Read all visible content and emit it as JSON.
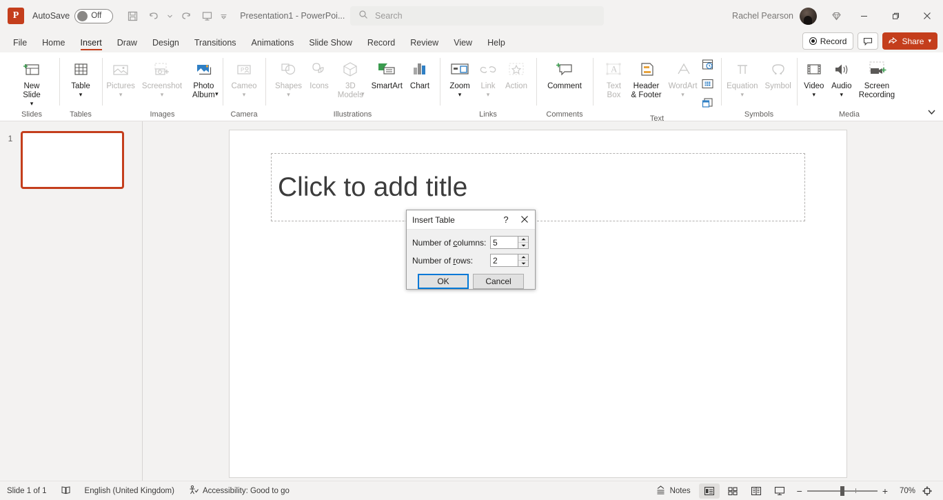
{
  "titlebar": {
    "app_icon": "powerpoint-logo",
    "app_initial": "P",
    "autosave_label": "AutoSave",
    "autosave_state": "Off",
    "quick_access": [
      {
        "name": "save-icon",
        "label": "Save"
      },
      {
        "name": "undo-icon",
        "label": "Undo"
      },
      {
        "name": "undo-dropdown-icon",
        "label": ""
      },
      {
        "name": "redo-icon",
        "label": "Redo"
      },
      {
        "name": "start-presentation-icon",
        "label": "Start From Beginning"
      },
      {
        "name": "customize-quick-access-toolbar-icon",
        "label": ""
      }
    ],
    "document_title": "Presentation1  -  PowerPoi...",
    "user_name": "Rachel Pearson",
    "window_buttons": [
      "minimize",
      "restore",
      "close"
    ]
  },
  "search": {
    "placeholder": "Search",
    "icon": "search-icon"
  },
  "tabs": [
    {
      "label": "File",
      "active": false
    },
    {
      "label": "Home",
      "active": false
    },
    {
      "label": "Insert",
      "active": true
    },
    {
      "label": "Draw",
      "active": false
    },
    {
      "label": "Design",
      "active": false
    },
    {
      "label": "Transitions",
      "active": false
    },
    {
      "label": "Animations",
      "active": false
    },
    {
      "label": "Slide Show",
      "active": false
    },
    {
      "label": "Record",
      "active": false
    },
    {
      "label": "Review",
      "active": false
    },
    {
      "label": "View",
      "active": false
    },
    {
      "label": "Help",
      "active": false
    }
  ],
  "tabbar_right": {
    "record_label": "Record",
    "comments_icon": "comment-icon",
    "share_label": "Share"
  },
  "ribbon": {
    "groups": [
      {
        "name": "Slides",
        "items": [
          {
            "label": "New\nSlide",
            "icon": "new-slide-icon",
            "disabled": false,
            "dropdown": true
          }
        ]
      },
      {
        "name": "Tables",
        "items": [
          {
            "label": "Table",
            "icon": "table-icon",
            "disabled": false,
            "dropdown": true
          }
        ]
      },
      {
        "name": "Images",
        "items": [
          {
            "label": "Pictures",
            "icon": "pictures-icon",
            "disabled": true,
            "dropdown": true
          },
          {
            "label": "Screenshot",
            "icon": "screenshot-icon",
            "disabled": true,
            "dropdown": true
          },
          {
            "label": "Photo\nAlbum",
            "icon": "photo-album-icon",
            "disabled": false,
            "dropdown": true
          }
        ]
      },
      {
        "name": "Camera",
        "items": [
          {
            "label": "Cameo",
            "icon": "cameo-icon",
            "disabled": true,
            "dropdown": true
          }
        ]
      },
      {
        "name": "Illustrations",
        "items": [
          {
            "label": "Shapes",
            "icon": "shapes-icon",
            "disabled": true,
            "dropdown": true
          },
          {
            "label": "Icons",
            "icon": "icons-icon",
            "disabled": true,
            "dropdown": false
          },
          {
            "label": "3D\nModels",
            "icon": "3d-models-icon",
            "disabled": true,
            "dropdown": true
          },
          {
            "label": "SmartArt",
            "icon": "smartart-icon",
            "disabled": false,
            "dropdown": false
          },
          {
            "label": "Chart",
            "icon": "chart-icon",
            "disabled": false,
            "dropdown": false
          }
        ]
      },
      {
        "name": "Links",
        "items": [
          {
            "label": "Zoom",
            "icon": "zoom-icon",
            "disabled": false,
            "dropdown": true
          },
          {
            "label": "Link",
            "icon": "link-icon",
            "disabled": true,
            "dropdown": true
          },
          {
            "label": "Action",
            "icon": "action-icon",
            "disabled": true,
            "dropdown": false
          }
        ]
      },
      {
        "name": "Comments",
        "items": [
          {
            "label": "Comment",
            "icon": "comment-icon",
            "disabled": false,
            "dropdown": false
          }
        ]
      },
      {
        "name": "Text",
        "items": [
          {
            "label": "Text\nBox",
            "icon": "text-box-icon",
            "disabled": true,
            "dropdown": false
          },
          {
            "label": "Header\n& Footer",
            "icon": "header-footer-icon",
            "disabled": false,
            "dropdown": false
          },
          {
            "label": "WordArt",
            "icon": "wordart-icon",
            "disabled": true,
            "dropdown": true
          }
        ],
        "mini_items": [
          {
            "icon": "date-and-time-icon"
          },
          {
            "icon": "slide-number-icon"
          },
          {
            "icon": "object-icon"
          }
        ]
      },
      {
        "name": "Symbols",
        "items": [
          {
            "label": "Equation",
            "icon": "equation-icon",
            "disabled": true,
            "dropdown": true
          },
          {
            "label": "Symbol",
            "icon": "symbol-icon",
            "disabled": true,
            "dropdown": false
          }
        ]
      },
      {
        "name": "Media",
        "items": [
          {
            "label": "Video",
            "icon": "video-icon",
            "disabled": false,
            "dropdown": true
          },
          {
            "label": "Audio",
            "icon": "audio-icon",
            "disabled": false,
            "dropdown": true
          },
          {
            "label": "Screen\nRecording",
            "icon": "screen-recording-icon",
            "disabled": false,
            "dropdown": false
          }
        ]
      }
    ],
    "collapse_icon": "chevron-down-icon"
  },
  "thumbnails": [
    {
      "number": "1",
      "selected": true
    }
  ],
  "slide": {
    "title_placeholder": "Click to add title"
  },
  "dialog": {
    "title": "Insert Table",
    "help_icon": "?",
    "close_icon": "close-icon",
    "fields": [
      {
        "label_pre": "Number of ",
        "label_key": "c",
        "label_post": "olumns:",
        "value": "5"
      },
      {
        "label_pre": "Number of ",
        "label_key": "r",
        "label_post": "ows:",
        "value": "2"
      }
    ],
    "ok_label": "OK",
    "cancel_label": "Cancel",
    "default_button": "OK"
  },
  "statusbar": {
    "slide_count": "Slide 1 of 1",
    "language_icon": "spell-check-icon",
    "language": "English (United Kingdom)",
    "accessibility_icon": "accessibility-icon",
    "accessibility": "Accessibility: Good to go",
    "notes_label": "Notes",
    "views": [
      {
        "name": "normal-view",
        "active": true
      },
      {
        "name": "slide-sorter-view",
        "active": false
      },
      {
        "name": "reading-view",
        "active": false
      },
      {
        "name": "slide-show-view",
        "active": false
      }
    ],
    "zoom_out_label": "−",
    "zoom_in_label": "+",
    "zoom_level": "70%",
    "fit_icon": "fit-to-window-icon"
  },
  "colors": {
    "accent": "#c43e1c",
    "chrome": "#f3f2f1",
    "focus_blue": "#0078d7"
  }
}
